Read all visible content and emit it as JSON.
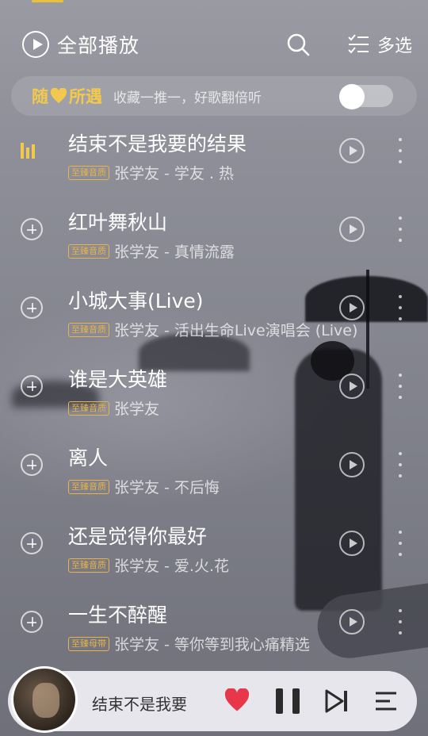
{
  "header": {
    "play_all_label": "全部播放",
    "multi_select_label": "多选"
  },
  "shuffle": {
    "title_left": "随",
    "title_right": "所遇",
    "description": "收藏一推一，好歌翻倍听",
    "toggle_on": false
  },
  "songs": [
    {
      "title": "结束不是我要的结果",
      "badge": "至臻音质",
      "artist": "张学友 - 学友 . 热",
      "playing": true
    },
    {
      "title": "红叶舞秋山",
      "badge": "至臻音质",
      "artist": "张学友 - 真情流露",
      "playing": false
    },
    {
      "title": "小城大事(Live)",
      "badge": "至臻音质",
      "artist": "张学友 - 活出生命Live演唱会 (Live)",
      "playing": false
    },
    {
      "title": "谁是大英雄",
      "badge": "至臻音质",
      "artist": "张学友",
      "playing": false
    },
    {
      "title": "离人",
      "badge": "至臻音质",
      "artist": "张学友 - 不后悔",
      "playing": false
    },
    {
      "title": "还是觉得你最好",
      "badge": "至臻音质",
      "artist": "张学友 - 爱.火.花",
      "playing": false
    },
    {
      "title": "一生不醉醒",
      "badge": "至臻母带",
      "artist": "张学友 - 等你等到我心痛精选",
      "playing": false
    }
  ],
  "player": {
    "title": "结束不是我要"
  },
  "colors": {
    "accent_gold": "#f2c94c",
    "heart_red": "#e8374a"
  }
}
